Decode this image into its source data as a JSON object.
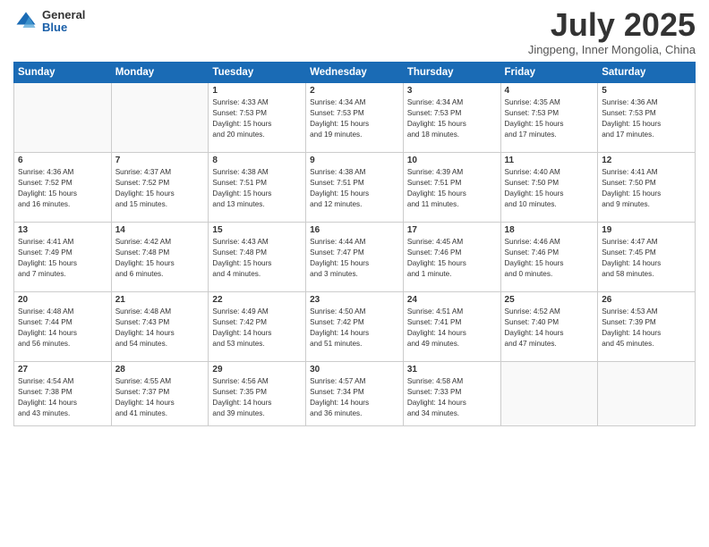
{
  "header": {
    "logo": {
      "general": "General",
      "blue": "Blue"
    },
    "month": "July 2025",
    "location": "Jingpeng, Inner Mongolia, China"
  },
  "weekdays": [
    "Sunday",
    "Monday",
    "Tuesday",
    "Wednesday",
    "Thursday",
    "Friday",
    "Saturday"
  ],
  "weeks": [
    [
      {
        "day": "",
        "info": ""
      },
      {
        "day": "",
        "info": ""
      },
      {
        "day": "1",
        "info": "Sunrise: 4:33 AM\nSunset: 7:53 PM\nDaylight: 15 hours\nand 20 minutes."
      },
      {
        "day": "2",
        "info": "Sunrise: 4:34 AM\nSunset: 7:53 PM\nDaylight: 15 hours\nand 19 minutes."
      },
      {
        "day": "3",
        "info": "Sunrise: 4:34 AM\nSunset: 7:53 PM\nDaylight: 15 hours\nand 18 minutes."
      },
      {
        "day": "4",
        "info": "Sunrise: 4:35 AM\nSunset: 7:53 PM\nDaylight: 15 hours\nand 17 minutes."
      },
      {
        "day": "5",
        "info": "Sunrise: 4:36 AM\nSunset: 7:53 PM\nDaylight: 15 hours\nand 17 minutes."
      }
    ],
    [
      {
        "day": "6",
        "info": "Sunrise: 4:36 AM\nSunset: 7:52 PM\nDaylight: 15 hours\nand 16 minutes."
      },
      {
        "day": "7",
        "info": "Sunrise: 4:37 AM\nSunset: 7:52 PM\nDaylight: 15 hours\nand 15 minutes."
      },
      {
        "day": "8",
        "info": "Sunrise: 4:38 AM\nSunset: 7:51 PM\nDaylight: 15 hours\nand 13 minutes."
      },
      {
        "day": "9",
        "info": "Sunrise: 4:38 AM\nSunset: 7:51 PM\nDaylight: 15 hours\nand 12 minutes."
      },
      {
        "day": "10",
        "info": "Sunrise: 4:39 AM\nSunset: 7:51 PM\nDaylight: 15 hours\nand 11 minutes."
      },
      {
        "day": "11",
        "info": "Sunrise: 4:40 AM\nSunset: 7:50 PM\nDaylight: 15 hours\nand 10 minutes."
      },
      {
        "day": "12",
        "info": "Sunrise: 4:41 AM\nSunset: 7:50 PM\nDaylight: 15 hours\nand 9 minutes."
      }
    ],
    [
      {
        "day": "13",
        "info": "Sunrise: 4:41 AM\nSunset: 7:49 PM\nDaylight: 15 hours\nand 7 minutes."
      },
      {
        "day": "14",
        "info": "Sunrise: 4:42 AM\nSunset: 7:48 PM\nDaylight: 15 hours\nand 6 minutes."
      },
      {
        "day": "15",
        "info": "Sunrise: 4:43 AM\nSunset: 7:48 PM\nDaylight: 15 hours\nand 4 minutes."
      },
      {
        "day": "16",
        "info": "Sunrise: 4:44 AM\nSunset: 7:47 PM\nDaylight: 15 hours\nand 3 minutes."
      },
      {
        "day": "17",
        "info": "Sunrise: 4:45 AM\nSunset: 7:46 PM\nDaylight: 15 hours\nand 1 minute."
      },
      {
        "day": "18",
        "info": "Sunrise: 4:46 AM\nSunset: 7:46 PM\nDaylight: 15 hours\nand 0 minutes."
      },
      {
        "day": "19",
        "info": "Sunrise: 4:47 AM\nSunset: 7:45 PM\nDaylight: 14 hours\nand 58 minutes."
      }
    ],
    [
      {
        "day": "20",
        "info": "Sunrise: 4:48 AM\nSunset: 7:44 PM\nDaylight: 14 hours\nand 56 minutes."
      },
      {
        "day": "21",
        "info": "Sunrise: 4:48 AM\nSunset: 7:43 PM\nDaylight: 14 hours\nand 54 minutes."
      },
      {
        "day": "22",
        "info": "Sunrise: 4:49 AM\nSunset: 7:42 PM\nDaylight: 14 hours\nand 53 minutes."
      },
      {
        "day": "23",
        "info": "Sunrise: 4:50 AM\nSunset: 7:42 PM\nDaylight: 14 hours\nand 51 minutes."
      },
      {
        "day": "24",
        "info": "Sunrise: 4:51 AM\nSunset: 7:41 PM\nDaylight: 14 hours\nand 49 minutes."
      },
      {
        "day": "25",
        "info": "Sunrise: 4:52 AM\nSunset: 7:40 PM\nDaylight: 14 hours\nand 47 minutes."
      },
      {
        "day": "26",
        "info": "Sunrise: 4:53 AM\nSunset: 7:39 PM\nDaylight: 14 hours\nand 45 minutes."
      }
    ],
    [
      {
        "day": "27",
        "info": "Sunrise: 4:54 AM\nSunset: 7:38 PM\nDaylight: 14 hours\nand 43 minutes."
      },
      {
        "day": "28",
        "info": "Sunrise: 4:55 AM\nSunset: 7:37 PM\nDaylight: 14 hours\nand 41 minutes."
      },
      {
        "day": "29",
        "info": "Sunrise: 4:56 AM\nSunset: 7:35 PM\nDaylight: 14 hours\nand 39 minutes."
      },
      {
        "day": "30",
        "info": "Sunrise: 4:57 AM\nSunset: 7:34 PM\nDaylight: 14 hours\nand 36 minutes."
      },
      {
        "day": "31",
        "info": "Sunrise: 4:58 AM\nSunset: 7:33 PM\nDaylight: 14 hours\nand 34 minutes."
      },
      {
        "day": "",
        "info": ""
      },
      {
        "day": "",
        "info": ""
      }
    ]
  ]
}
